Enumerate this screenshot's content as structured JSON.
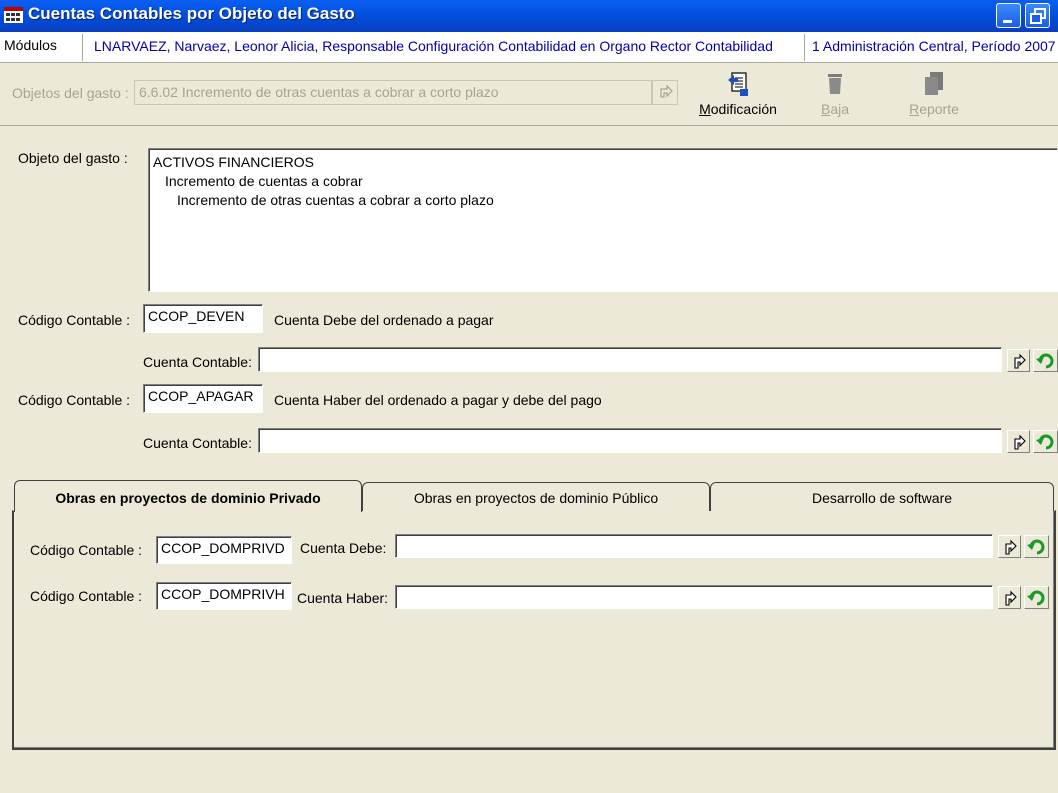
{
  "window": {
    "title": "Cuentas Contables por Objeto del Gasto",
    "icon": "app-icon"
  },
  "infobar": {
    "modules_label": "Módulos",
    "user": "LNARVAEZ, Narvaez, Leonor Alicia, Responsable Configuración Contabilidad en Organo Rector Contabilidad",
    "period": "1 Administración Central, Período 2007"
  },
  "toolbar": {
    "objetos_label": "Objetos del gasto :",
    "objetos_value": "6.6.02 Incremento de otras cuentas a cobrar a corto plazo",
    "modificacion_label": "Modificación",
    "baja_label": "Baja",
    "reporte_label": "Reporte"
  },
  "objeto": {
    "label": "Objeto del gasto :",
    "lines": [
      "ACTIVOS FINANCIEROS",
      "Incremento de cuentas a cobrar",
      "Incremento de otras cuentas a cobrar a corto plazo"
    ]
  },
  "codigo1": {
    "label": "Código Contable :",
    "code": "CCOP_DEVEN",
    "description": "Cuenta Debe del ordenado a pagar",
    "cuenta_label": "Cuenta Contable:",
    "cuenta_value": ""
  },
  "codigo2": {
    "label": "Código Contable :",
    "code": "CCOP_APAGAR",
    "description": "Cuenta Haber del ordenado a pagar y debe del pago",
    "cuenta_label": "Cuenta Contable:",
    "cuenta_value": ""
  },
  "tabs": [
    {
      "label": "Obras en proyectos de dominio Privado",
      "active": true
    },
    {
      "label": "Obras en proyectos de dominio Público",
      "active": false
    },
    {
      "label": "Desarrollo de software",
      "active": false
    }
  ],
  "tab_privado": {
    "row1": {
      "label": "Código Contable :",
      "code": "CCOP_DOMPRIVD",
      "cuenta_label": "Cuenta Debe:",
      "cuenta_value": ""
    },
    "row2": {
      "label": "Código Contable :",
      "code": "CCOP_DOMPRIVH",
      "cuenta_label": "Cuenta Haber:",
      "cuenta_value": ""
    }
  },
  "colors": {
    "title_bar": "#0454e3",
    "info_text": "#0000aa",
    "window_bg": "#ece9d8",
    "disabled_text": "#a8a491"
  }
}
